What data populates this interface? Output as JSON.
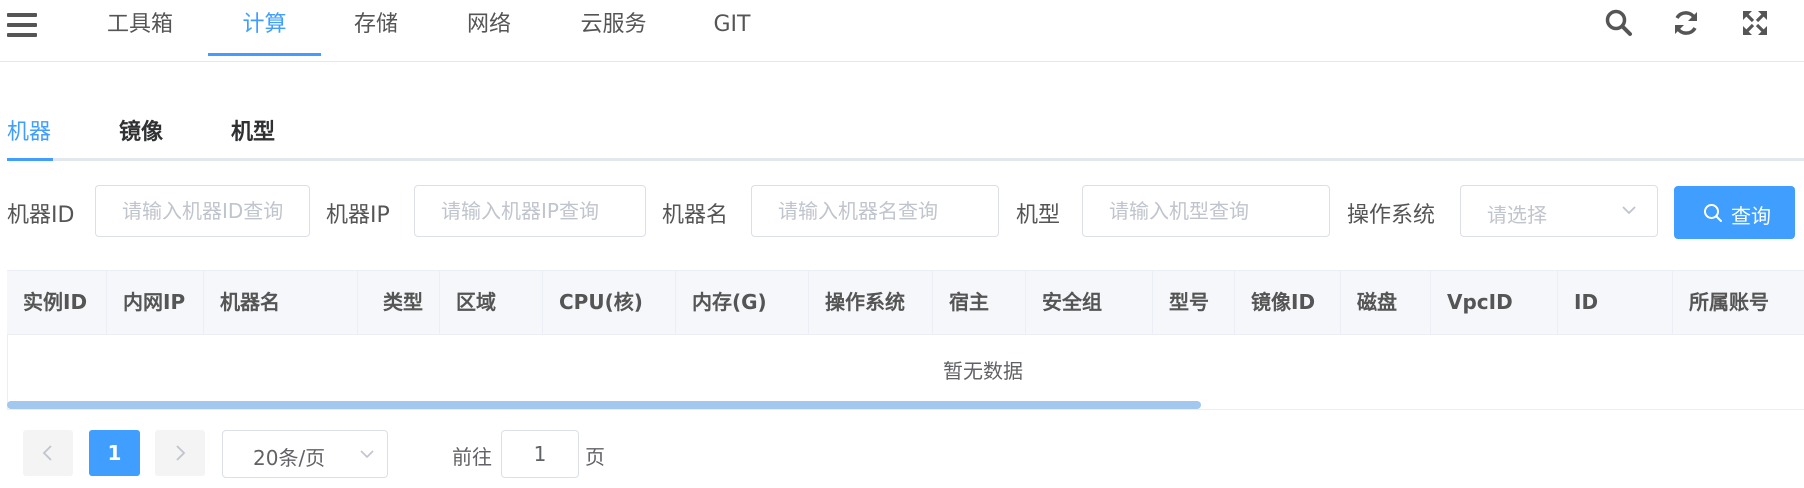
{
  "nav": {
    "tabs": [
      "工具箱",
      "计算",
      "存储",
      "网络",
      "云服务",
      "GIT"
    ],
    "active_tab": "计算",
    "icons": [
      "menu-icon",
      "search-icon",
      "refresh-icon",
      "fullscreen-icon"
    ]
  },
  "subtabs": {
    "items": [
      "机器",
      "镜像",
      "机型"
    ],
    "active": "机器"
  },
  "filters": {
    "machine_id": {
      "label": "机器ID",
      "placeholder": "请输入机器ID查询"
    },
    "machine_ip": {
      "label": "机器IP",
      "placeholder": "请输入机器IP查询"
    },
    "machine_name": {
      "label": "机器名",
      "placeholder": "请输入机器名查询"
    },
    "machine_type": {
      "label": "机型",
      "placeholder": "请输入机型查询"
    },
    "os": {
      "label": "操作系统",
      "placeholder": "请选择"
    },
    "query_label": "查询"
  },
  "table": {
    "columns": [
      "实例ID",
      "内网IP",
      "机器名",
      "类型",
      "区域",
      "CPU(核)",
      "内存(G)",
      "操作系统",
      "宿主",
      "安全组",
      "型号",
      "镜像ID",
      "磁盘",
      "VpcID",
      "ID",
      "所属账号"
    ],
    "empty_text": "暂无数据"
  },
  "pagination": {
    "current_page": "1",
    "page_size": "20条/页",
    "goto_label": "前往",
    "goto_value": "1",
    "page_suffix": "页"
  },
  "colors": {
    "accent": "#409eff",
    "header_bg": "#f5f7fa",
    "scrollbar": "#a3c8ef"
  }
}
